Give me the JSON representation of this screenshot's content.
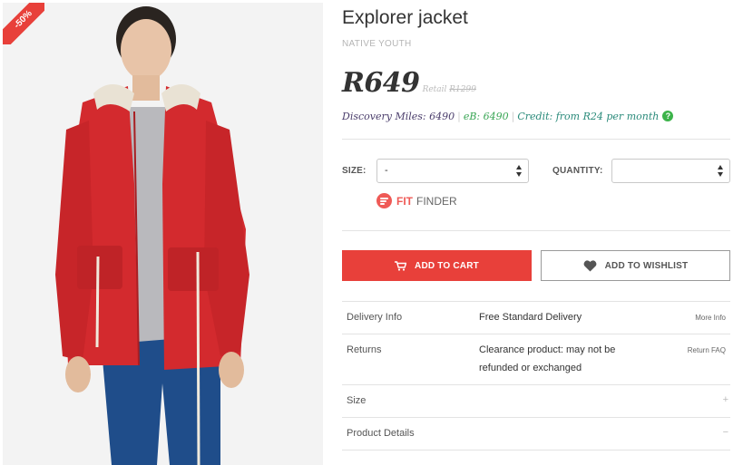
{
  "product": {
    "sale_badge": "-50%",
    "title": "Explorer jacket",
    "brand": "NATIVE YOUTH",
    "price": "R649",
    "retail_prefix": "Retail",
    "retail_price": "R1299",
    "discovery_miles": "Discovery Miles: 6490",
    "ebucks": "eB: 6490",
    "credit": "Credit: from R24 per month",
    "help_glyph": "?"
  },
  "options": {
    "size_label": "SIZE:",
    "size_value": "-",
    "quantity_label": "QUANTITY:",
    "quantity_value": ""
  },
  "fit_finder": {
    "fit": "FIT",
    "finder": "FINDER"
  },
  "actions": {
    "add_to_cart": "ADD TO CART",
    "add_to_wishlist": "ADD TO WISHLIST"
  },
  "info": {
    "delivery_label": "Delivery Info",
    "delivery_value": "Free Standard Delivery",
    "delivery_link": "More Info",
    "returns_label": "Returns",
    "returns_value": "Clearance product: may not be refunded or exchanged",
    "returns_link": "Return FAQ",
    "size_label": "Size",
    "size_toggle": "+",
    "details_label": "Product Details",
    "details_toggle": "−"
  },
  "colors": {
    "accent": "#e8403a",
    "ebucks": "#3aa655",
    "credit": "#2a8a7a",
    "miles": "#4a3d6b"
  },
  "icons": {
    "cart": "cart-icon",
    "wishlist": "heart-icon",
    "fit_finder": "fit-finder-icon",
    "help": "help-icon"
  }
}
